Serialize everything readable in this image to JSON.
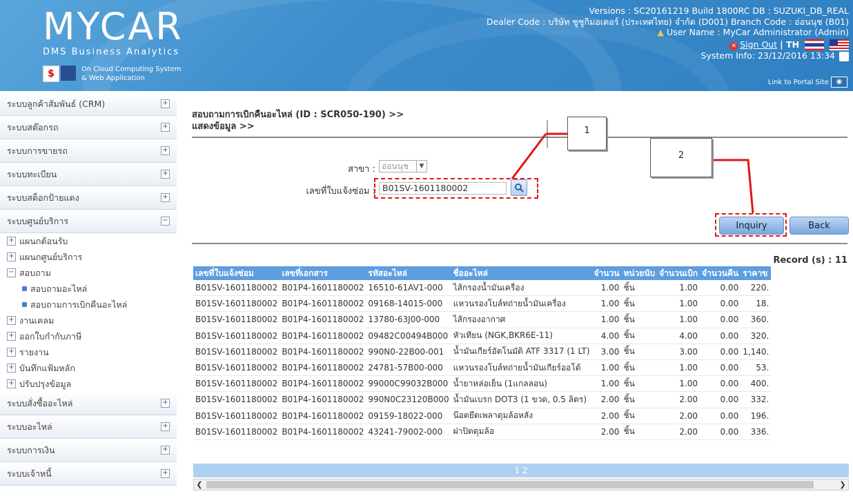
{
  "header": {
    "logo": "MYCAR",
    "logo_sub": "DMS Business Analytics",
    "tag1": "On Cloud Computing System",
    "tag2": "& Web Application",
    "versions": "Versions : SC20161219 Build 1800RC DB : SUZUKI_DB_REAL",
    "dealer": "Dealer Code : บริษัท ซูซูกิมอเตอร์ (ประเทศไทย) จำกัด (D001)  Branch Code : อ่อนนุช (B01)",
    "user": "User Name : MyCar Administrator  (Admin)",
    "sign_out": "Sign Out",
    "lang": "| TH",
    "system_info": "System Info: 23/12/2016 13:34",
    "portal_link": "Link to Portal Site"
  },
  "sidebar": {
    "items_top": [
      "ระบบลูกค้าสัมพันธ์ (CRM)",
      "ระบบสต๊อกรถ",
      "ระบบการขายรถ",
      "ระบบทะเบียน",
      "ระบบสต็อกป้ายแดง",
      "ระบบศูนย์บริการ"
    ],
    "sub": [
      "แผนกต้อนรับ",
      "แผนกศูนย์บริการ",
      "สอบถาม"
    ],
    "subsub": [
      "สอบถามอะไหล่",
      "สอบถามการเบิกคืนอะไหล่"
    ],
    "sub2": [
      "งานเคลม",
      "ออกใบกำกับภาษี",
      "รายงาน",
      "บันทึกแฟ้มหลัก",
      "ปรับปรุงข้อมูล"
    ],
    "items_bottom": [
      "ระบบสั่งซื้ออะไหล่",
      "ระบบอะไหล่",
      "ระบบการเงิน",
      "ระบบเจ้าหนี้"
    ]
  },
  "main": {
    "title1": "สอบถามการเบิกคืนอะไหล่ (ID : SCR050-190) >>",
    "title2": "แสดงข้อมูล >>",
    "branch_label": "สาขา :",
    "branch_value": "อ่อนนุช",
    "repair_label": "เลขที่ใบแจ้งซ่อม :",
    "repair_value": "B01SV-1601180002",
    "callout1": "1",
    "callout2": "2",
    "inquiry": "Inquiry",
    "back": "Back",
    "record": "Record (s) : 11",
    "columns": [
      "เลขที่ใบแจ้งซ่อม",
      "เลขที่เอกสาร",
      "รหัสอะไหล่",
      "ชื่ออะไหล่",
      "จำนวน",
      "หน่วยนับ",
      "จำนวนเบิก",
      "จำนวนคืน",
      "ราคาข"
    ],
    "rows": [
      [
        "B01SV-1601180002",
        "B01P4-1601180002",
        "16510-61AV1-000",
        "ไส้กรองน้ำมันเครื่อง",
        "1.00",
        "ชิ้น",
        "1.00",
        "0.00",
        "220."
      ],
      [
        "B01SV-1601180002",
        "B01P4-1601180002",
        "09168-14015-000",
        "แหวนรองโบล์ทถ่ายน้ำมันเครื่อง",
        "1.00",
        "ชิ้น",
        "1.00",
        "0.00",
        "18."
      ],
      [
        "B01SV-1601180002",
        "B01P4-1601180002",
        "13780-63J00-000",
        "ไส้กรองอากาศ",
        "1.00",
        "ชิ้น",
        "1.00",
        "0.00",
        "360."
      ],
      [
        "B01SV-1601180002",
        "B01P4-1601180002",
        "09482C00494B000",
        "หัวเทียน (NGK,BKR6E-11)",
        "4.00",
        "ชิ้น",
        "4.00",
        "0.00",
        "320."
      ],
      [
        "B01SV-1601180002",
        "B01P4-1601180002",
        "990N0-22B00-001",
        "น้ำมันเกียร์อัตโนมัติ ATF 3317 (1 LT)",
        "3.00",
        "ชิ้น",
        "3.00",
        "0.00",
        "1,140."
      ],
      [
        "B01SV-1601180002",
        "B01P4-1601180002",
        "24781-57B00-000",
        "แหวนรองโบล์ทถ่ายน้ำมันเกียร์ออโต้",
        "1.00",
        "ชิ้น",
        "1.00",
        "0.00",
        "53."
      ],
      [
        "B01SV-1601180002",
        "B01P4-1601180002",
        "99000C99032B000",
        "น้ำยาหล่อเย็น (1แกลลอน)",
        "1.00",
        "ชิ้น",
        "1.00",
        "0.00",
        "400."
      ],
      [
        "B01SV-1601180002",
        "B01P4-1601180002",
        "990N0C23120B000",
        "น้ำมันเบรก DOT3 (1 ขวด, 0.5 ลิตร)",
        "2.00",
        "ชิ้น",
        "2.00",
        "0.00",
        "332."
      ],
      [
        "B01SV-1601180002",
        "B01P4-1601180002",
        "09159-18022-000",
        "น๊อตยึดเพลาดุมล้อหลัง",
        "2.00",
        "ชิ้น",
        "2.00",
        "0.00",
        "196."
      ],
      [
        "B01SV-1601180002",
        "B01P4-1601180002",
        "43241-79002-000",
        "ฝาปิดดุมล้อ",
        "2.00",
        "ชิ้น",
        "2.00",
        "0.00",
        "336."
      ]
    ],
    "pager": "1 2"
  },
  "colors": {
    "header_blue": "#3d8dcc",
    "table_header": "#5c9ee0",
    "annotation_red": "#e01616"
  }
}
